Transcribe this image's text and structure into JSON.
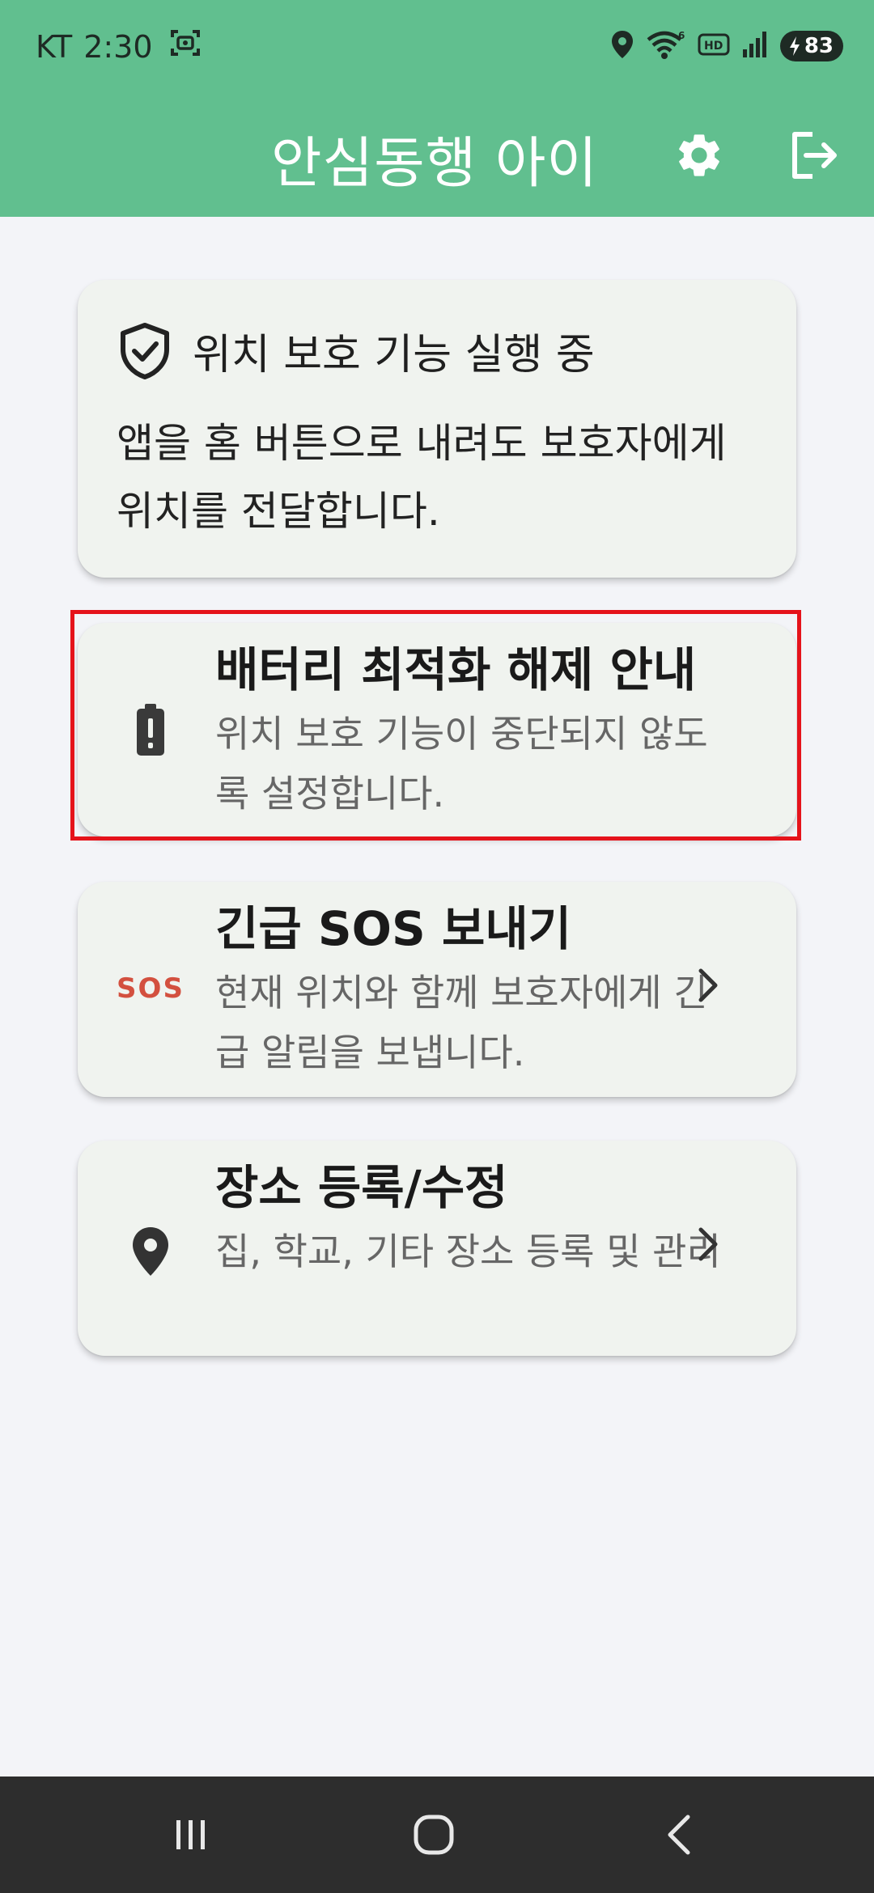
{
  "status_bar": {
    "carrier": "KT",
    "time": "2:30",
    "battery_level": "83",
    "icons": [
      "screenshot-icon",
      "location-icon",
      "wifi-icon",
      "hd-icon",
      "signal-icon",
      "battery-charging-icon"
    ]
  },
  "app_bar": {
    "title": "안심동행 아이",
    "actions": [
      "gear-icon",
      "logout-icon"
    ]
  },
  "status_card": {
    "icon": "shield-check-icon",
    "title": "위치 보호 기능 실행 중",
    "description": "앱을 홈 버튼으로 내려도 보호자에게 위치를 전달합니다."
  },
  "menu_cards": [
    {
      "icon": "battery-alert-icon",
      "title": "배터리 최적화 해제 안내",
      "description": "위치 보호 기능이 중단되지 않도록 설정합니다."
    },
    {
      "icon": "sos-icon",
      "icon_label": "SOS",
      "title": "긴급 SOS 보내기",
      "description": "현재 위치와 함께 보호자에게 긴급 알림을 보냅니다.",
      "chevron": true
    },
    {
      "icon": "map-pin-icon",
      "title": "장소 등록/수정",
      "description": "집, 학교, 기타 장소 등록 및 관리",
      "chevron": true
    }
  ],
  "nav_bar": {
    "buttons": [
      "recents-icon",
      "home-icon",
      "back-icon"
    ]
  },
  "colors": {
    "header_green": "#61bf8f",
    "background": "#f3f4f8",
    "card": "#f0f3ef",
    "sos_red": "#d3503f",
    "highlight_red": "#e5131b",
    "nav_bar": "#2d2d2d"
  }
}
